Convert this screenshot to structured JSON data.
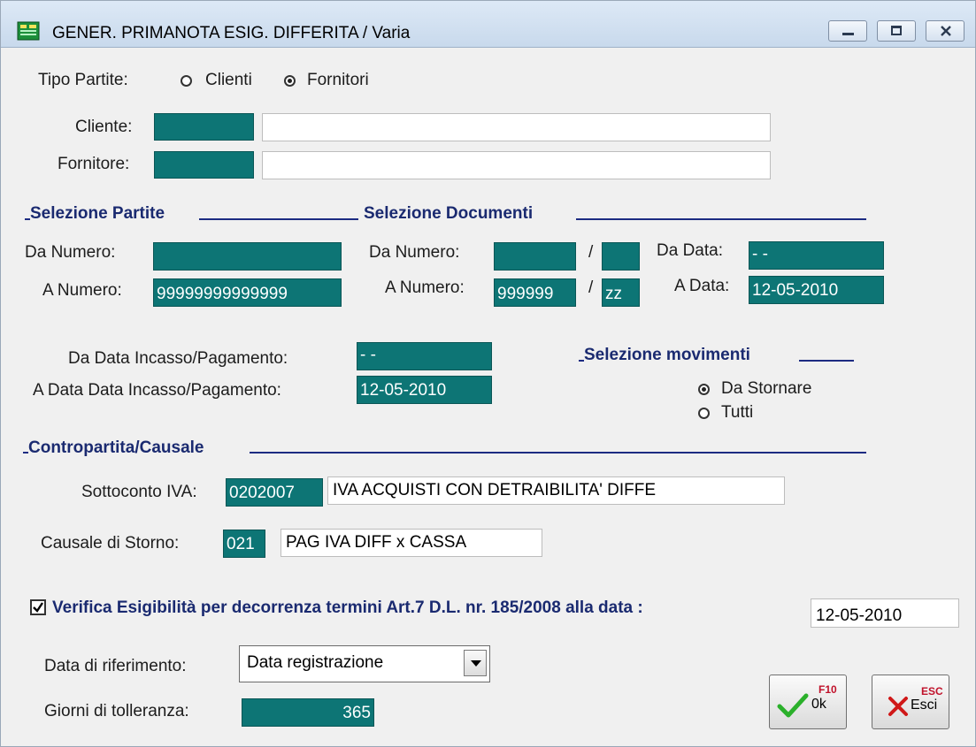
{
  "window": {
    "title": "GENER. PRIMANOTA ESIG. DIFFERITA / Varia"
  },
  "tipo_partite": {
    "label": "Tipo Partite:",
    "options": [
      "Clienti",
      "Fornitori"
    ],
    "selected": "Fornitori"
  },
  "cliente": {
    "label": "Cliente:",
    "code": "",
    "description": ""
  },
  "fornitore": {
    "label": "Fornitore:",
    "code": "",
    "description": ""
  },
  "sel_partite": {
    "heading": "Selezione Partite",
    "da_numero_label": "Da Numero:",
    "da_numero": "",
    "a_numero_label": "A Numero:",
    "a_numero": "99999999999999"
  },
  "sel_documenti": {
    "heading": "Selezione Documenti",
    "da_numero_label": "Da Numero:",
    "da_numero": "",
    "da_serie": "",
    "a_numero_label": "A Numero:",
    "a_numero": "999999",
    "a_serie": "zz",
    "slash": "/",
    "da_data_label": "Da Data:",
    "da_data": "  -  -",
    "a_data_label": "A Data:",
    "a_data": "12-05-2010"
  },
  "incasso": {
    "da_label": "Da Data Incasso/Pagamento:",
    "da_value": "  -  -",
    "a_label": "A Data Data Incasso/Pagamento:",
    "a_value": "12-05-2010"
  },
  "sel_movimenti": {
    "heading": "Selezione movimenti",
    "options": [
      "Da Stornare",
      "Tutti"
    ],
    "selected": "Da Stornare"
  },
  "contropartita": {
    "heading": "Contropartita/Causale",
    "sottoconto_label": "Sottoconto IVA:",
    "sottoconto_code": "0202007",
    "sottoconto_desc": "IVA ACQUISTI CON DETRAIBILITA' DIFFE",
    "causale_label": "Causale di Storno:",
    "causale_code": "021",
    "causale_desc": "PAG IVA DIFF x CASSA"
  },
  "verifica": {
    "label": "Verifica Esigibilità per decorrenza termini Art.7 D.L. nr. 185/2008 alla data :",
    "checked": true,
    "date": "12-05-2010"
  },
  "data_riferimento": {
    "label": "Data di riferimento:",
    "value": "Data registrazione"
  },
  "giorni": {
    "label": "Giorni di tolleranza:",
    "value": "365"
  },
  "buttons": {
    "ok": {
      "key": "F10",
      "label": "0k"
    },
    "esci": {
      "key": "ESC",
      "label": "Esci"
    }
  },
  "colors": {
    "field_bg": "#0d7575",
    "heading": "#1a2a70",
    "rule": "#1c2b82"
  }
}
